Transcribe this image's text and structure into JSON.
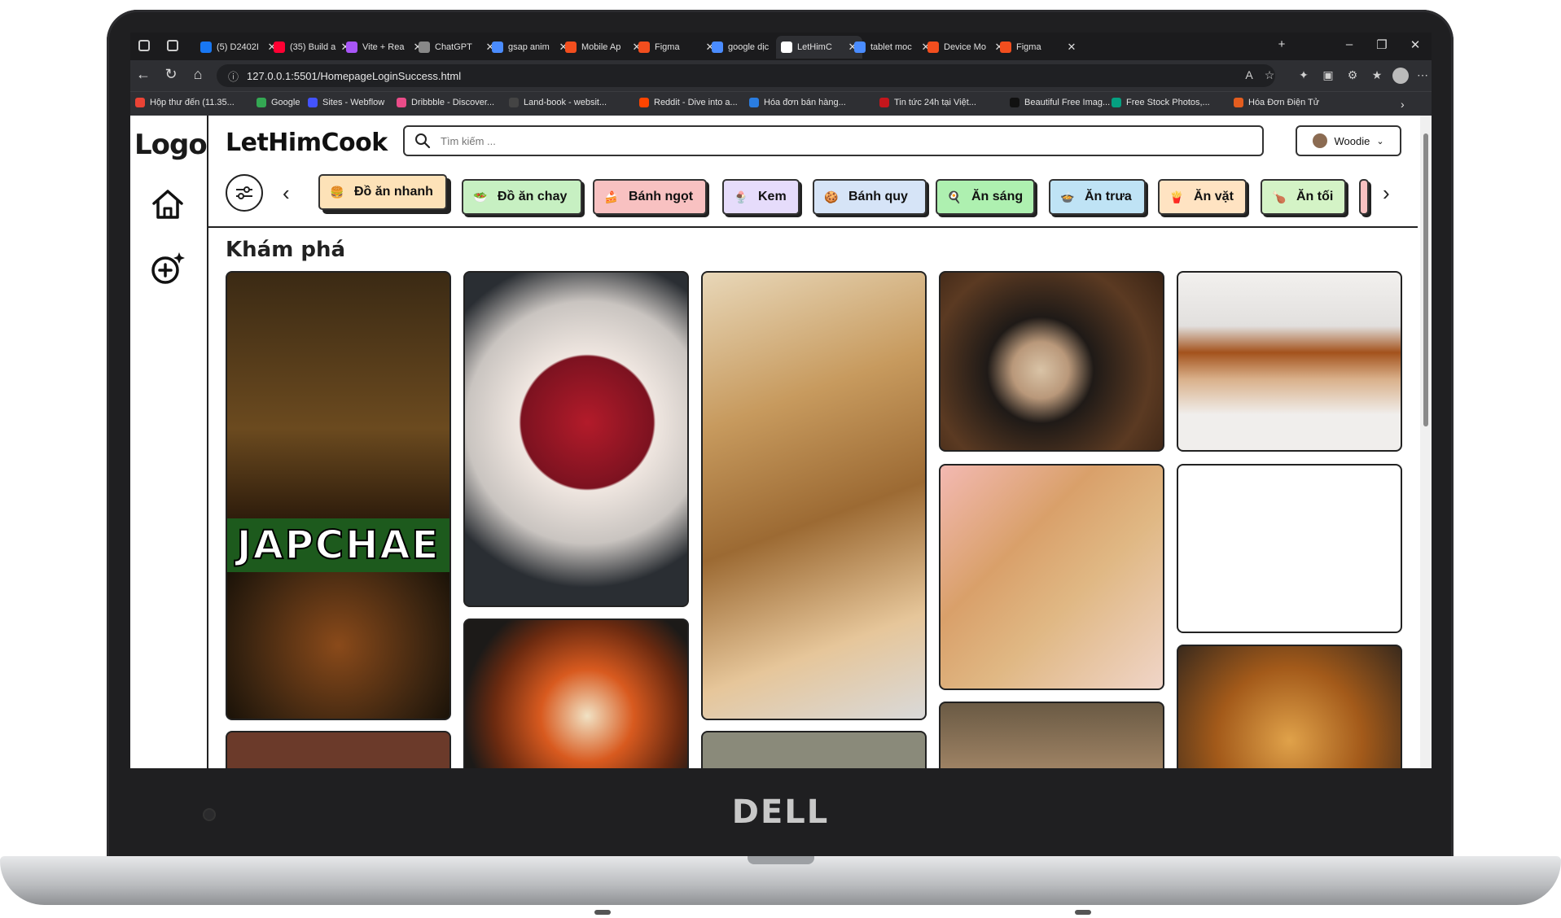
{
  "browser": {
    "tabs": [
      {
        "label": "(5) D2402I",
        "color": "#1877f2"
      },
      {
        "label": "(35) Build a",
        "color": "#ff0033"
      },
      {
        "label": "Vite + Rea",
        "color": "#a855f7"
      },
      {
        "label": "ChatGPT",
        "color": "#888888"
      },
      {
        "label": "gsap anim",
        "color": "#4a8cff"
      },
      {
        "label": "Mobile Ap",
        "color": "#f24e1e"
      },
      {
        "label": "Figma",
        "color": "#f24e1e"
      },
      {
        "label": "google dịc",
        "color": "#4a8cff"
      },
      {
        "label": "LetHimC",
        "color": "#ffffff"
      },
      {
        "label": "tablet moc",
        "color": "#4a8cff"
      },
      {
        "label": "Device Mo",
        "color": "#f24e1e"
      },
      {
        "label": "Figma",
        "color": "#f24e1e"
      }
    ],
    "active_tab": 8,
    "url": "127.0.0.1:5501/HomepageLoginSuccess.html",
    "bookmarks": [
      {
        "label": "Hộp thư đến (11.35...",
        "color": "#ea4335"
      },
      {
        "label": "Google",
        "color": "#34a853"
      },
      {
        "label": "Sites - Webflow",
        "color": "#4353ff"
      },
      {
        "label": "Dribbble - Discover...",
        "color": "#ea4c89"
      },
      {
        "label": "Land-book - websit...",
        "color": "#444444"
      },
      {
        "label": "Reddit - Dive into a...",
        "color": "#ff4500"
      },
      {
        "label": "Hóa đơn bán hàng...",
        "color": "#2a7de1"
      },
      {
        "label": "Tin tức 24h tại Việt...",
        "color": "#c4161c"
      },
      {
        "label": "Beautiful Free Imag...",
        "color": "#111111"
      },
      {
        "label": "Free Stock Photos,...",
        "color": "#05a081"
      },
      {
        "label": "Hóa Đơn Điện Tử",
        "color": "#e35d1f"
      }
    ]
  },
  "app": {
    "logo": "Logo",
    "site_name": "LetHimCook",
    "search_placeholder": "Tìm kiếm ...",
    "user_name": "Woodie",
    "section_title": "Khám phá",
    "categories": [
      {
        "label": "Đồ ăn nhanh",
        "bg": "#fde2b8",
        "selected": true
      },
      {
        "label": "Đồ ăn chay",
        "bg": "#c7f0c2",
        "selected": false
      },
      {
        "label": "Bánh ngọt",
        "bg": "#f8c1c1",
        "selected": false
      },
      {
        "label": "Kem",
        "bg": "#e6dcfb",
        "selected": false
      },
      {
        "label": "Bánh quy",
        "bg": "#d6e4f7",
        "selected": false
      },
      {
        "label": "Ăn sáng",
        "bg": "#aef0b0",
        "selected": false
      },
      {
        "label": "Ăn trưa",
        "bg": "#bfe3f5",
        "selected": false
      },
      {
        "label": "Ăn vặt",
        "bg": "#ffe3c2",
        "selected": false
      },
      {
        "label": "Ăn tối",
        "bg": "#d4f3c6",
        "selected": false
      }
    ],
    "feed": {
      "japchae_caption": "JAPCHAE"
    }
  },
  "device": {
    "brand": "DELL"
  }
}
